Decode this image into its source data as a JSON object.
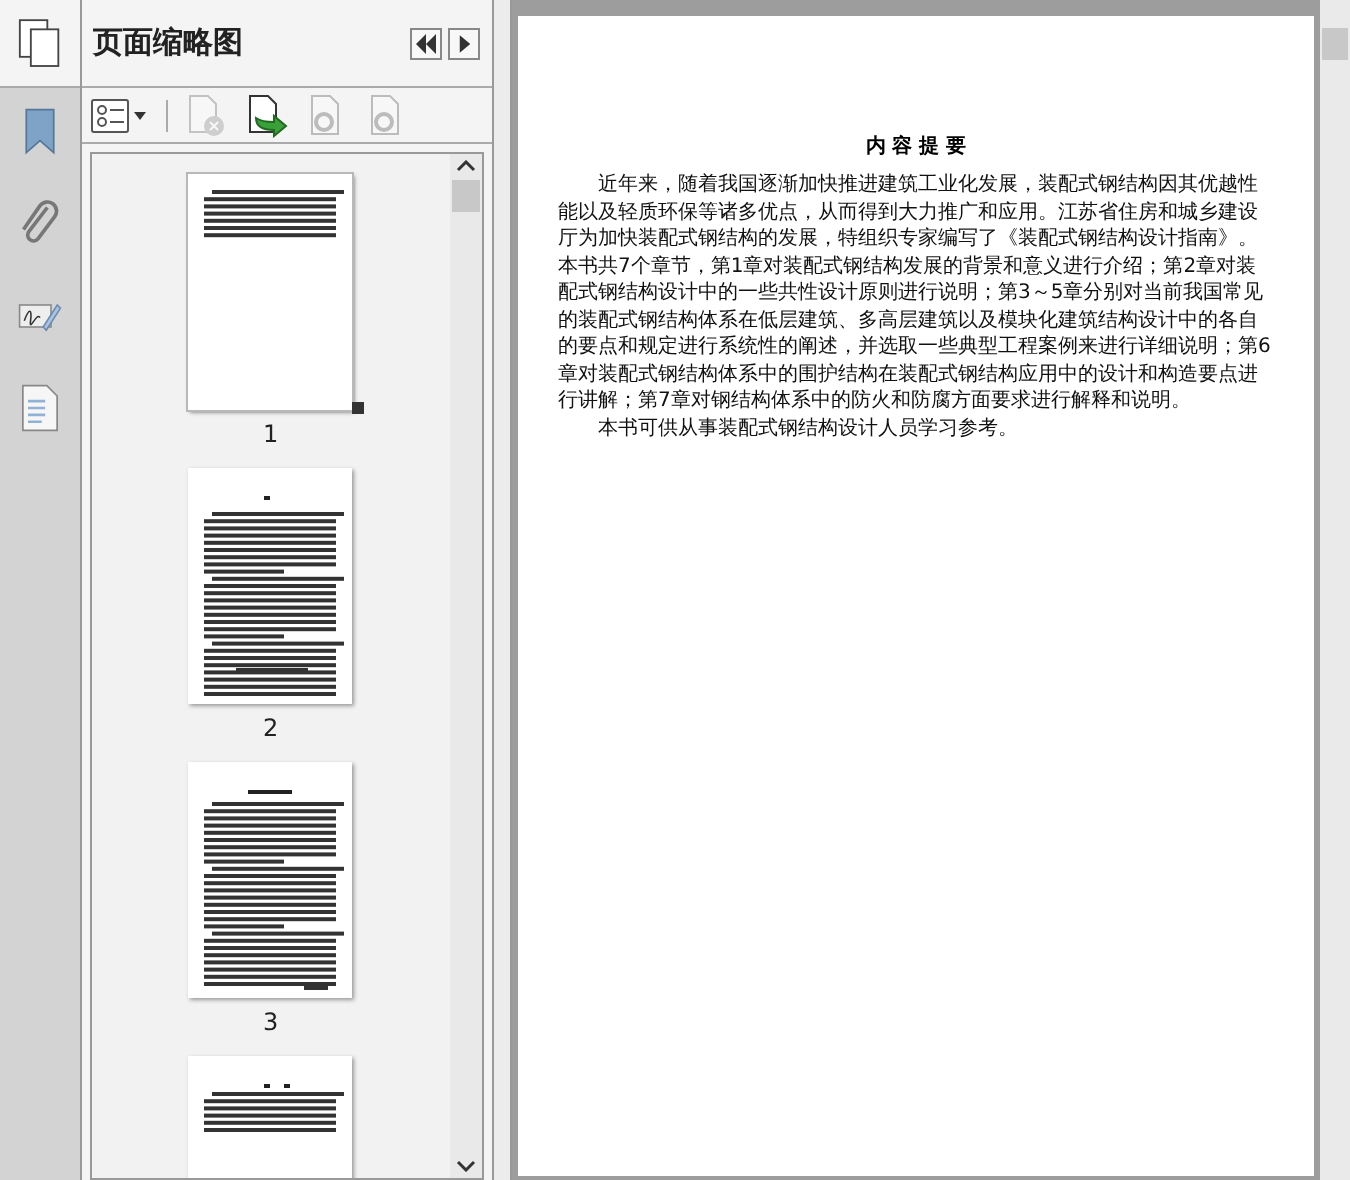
{
  "panel": {
    "title": "页面缩略图"
  },
  "toolbar": [
    {
      "kind": "options",
      "disabled": false
    },
    {
      "kind": "delete",
      "disabled": true
    },
    {
      "kind": "insert",
      "disabled": false
    },
    {
      "kind": "undo",
      "disabled": true
    },
    {
      "kind": "redo",
      "disabled": true
    }
  ],
  "thumbnails": [
    {
      "kind": "summary",
      "page": "1",
      "selected": true
    },
    {
      "kind": "body",
      "page": "2",
      "selected": false
    },
    {
      "kind": "chapter",
      "page": "3",
      "selected": false
    },
    {
      "kind": "heading",
      "selected": false
    }
  ],
  "document": {
    "heading": "内 容 提 要",
    "paragraphs": [
      "近年来，随着我国逐渐加快推进建筑工业化发展，装配式钢结构因其优越性能以及轻质环保等诸多优点，从而得到大力推广和应用。江苏省住房和城乡建设厅为加快装配式钢结构的发展，特组织专家编写了《装配式钢结构设计指南》。本书共7个章节，第1章对装配式钢结构发展的背景和意义进行介绍；第2章对装配式钢结构设计中的一些共性设计原则进行说明；第3～5章分别对当前我国常见的装配式钢结构体系在低层建筑、多高层建筑以及模块化建筑结构设计中的各自的要点和规定进行系统性的阐述，并选取一些典型工程案例来进行详细说明；第6章对装配式钢结构体系中的围护结构在装配式钢结构应用中的设计和构造要点进行讲解；第7章对钢结构体系中的防火和防腐方面要求进行解释和说明。",
      "本书可供从事装配式钢结构设计人员学习参考。"
    ]
  }
}
